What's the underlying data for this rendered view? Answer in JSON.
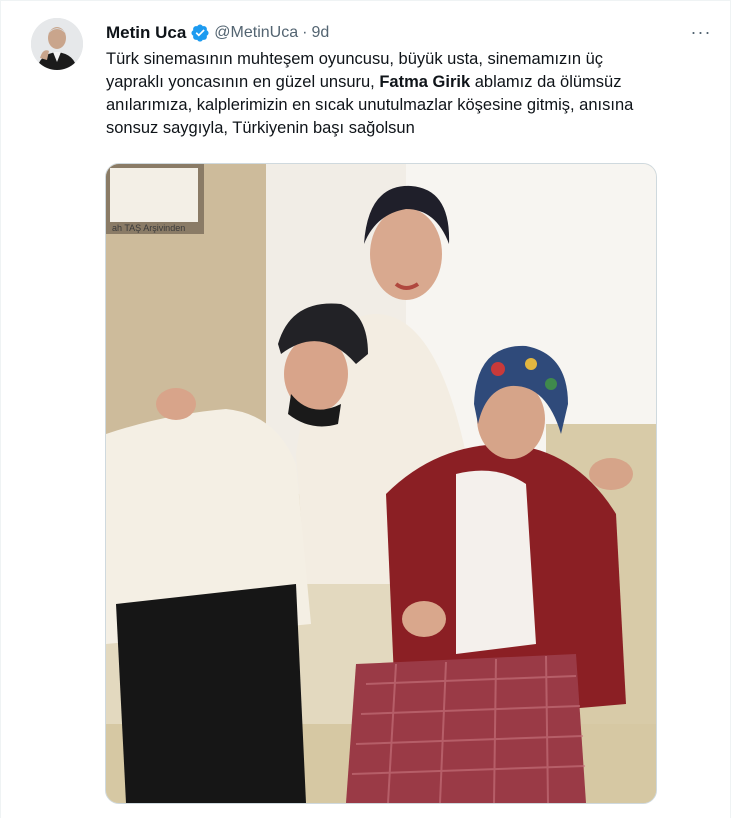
{
  "tweet": {
    "author_name": "Metin Uca",
    "author_handle": "@MetinUca",
    "separator": "·",
    "time": "9d",
    "more_label": "···",
    "text_line_1": "Türk sinemasının  muhteşem oyuncusu, büyük usta, sinemamızın üç",
    "text_line_2a": "yapraklı yoncasının en güzel unsuru, ",
    "text_mention": "Fatma Girik",
    "text_line_2b": " ablamız da  ölümsüz",
    "text_line_3": "anılarımıza, kalplerimizin en sıcak unutulmazlar köşesine gitmiş, anısına",
    "text_line_4": "sonsuz saygıyla, Türkiyenin başı sağolsun"
  },
  "media": {
    "archive_caption": "ah TAŞ Arşivinden"
  },
  "colors": {
    "verified_badge": "#1d9bf0",
    "secondary_text": "#536471",
    "primary_text": "#0f1419",
    "border": "#cfd9de"
  },
  "icons": {
    "verified": "verified-badge-icon",
    "more": "more-options-icon"
  }
}
